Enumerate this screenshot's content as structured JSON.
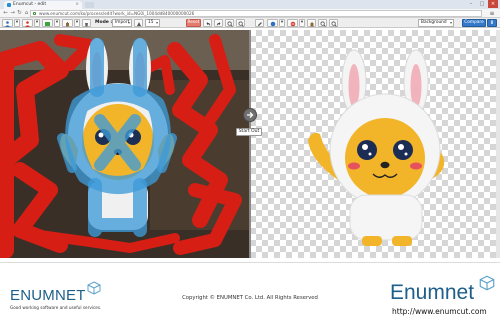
{
  "browser": {
    "tab_title": "Enumcut - edit",
    "tab_close": "×",
    "address": "www.enumcut.com/ko/process/edit?work_id=NG0i_1004dd840000000026",
    "window_controls": {
      "minimize": "–",
      "maximize": "□",
      "close": "×"
    },
    "nav": {
      "back": "←",
      "forward": "→",
      "reload": "↻",
      "home": "⌂"
    },
    "menu_glyph": "≡"
  },
  "toolbar": {
    "mode_label": "Mode :",
    "mode_value": "Import",
    "size_value": "15",
    "reset_label": "Reset",
    "background_value": "Background",
    "compare_label": "Compare",
    "download_glyph": "⬇",
    "dropdown_arrow": "▾"
  },
  "canvas": {
    "split_label": "Start Out"
  },
  "footer": {
    "logo_left": "ENUMNET",
    "tagline": "Good working software and useful services.",
    "copyright": "Copyright © ENUMNET Co. Ltd. All Rights Reserved",
    "logo_right": "Enumnet",
    "website": "http://www.enumcut.com"
  },
  "colors": {
    "brand": "#1d5f8a",
    "accent_blue": "#3479c9",
    "reset_red": "#e27b6e",
    "mask_red": "#d61e14",
    "mask_blue": "#3d9bd8"
  }
}
